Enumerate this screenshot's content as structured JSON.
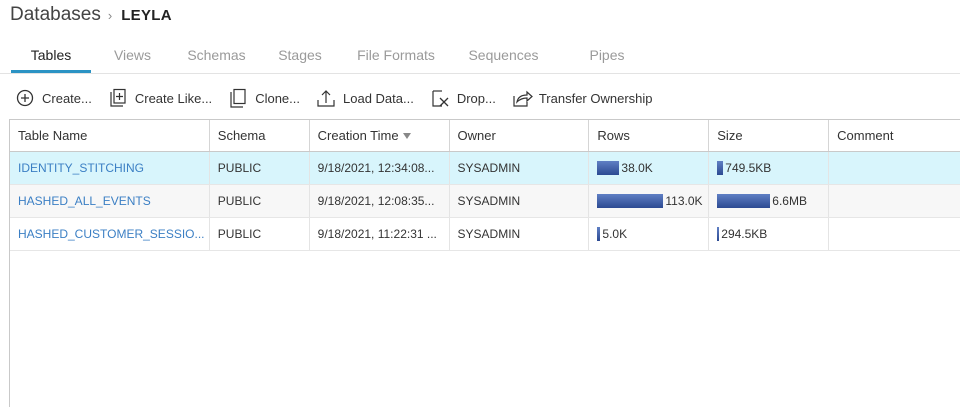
{
  "breadcrumb": {
    "root": "Databases",
    "separator": "›",
    "current": "LEYLA"
  },
  "tabs": [
    {
      "label": "Tables",
      "active": true
    },
    {
      "label": "Views",
      "active": false
    },
    {
      "label": "Schemas",
      "active": false
    },
    {
      "label": "Stages",
      "active": false
    },
    {
      "label": "File Formats",
      "active": false
    },
    {
      "label": "Sequences",
      "active": false
    },
    {
      "label": "Pipes",
      "active": false
    }
  ],
  "toolbar": {
    "create": "Create...",
    "create_like": "Create Like...",
    "clone": "Clone...",
    "load_data": "Load Data...",
    "drop": "Drop...",
    "transfer_ownership": "Transfer Ownership"
  },
  "table": {
    "columns": {
      "name": "Table Name",
      "schema": "Schema",
      "time": "Creation Time",
      "owner": "Owner",
      "rows": "Rows",
      "size": "Size",
      "comment": "Comment"
    },
    "rows": [
      {
        "name": "IDENTITY_STITCHING",
        "schema": "PUBLIC",
        "time": "9/18/2021, 12:34:08...",
        "owner": "SYSADMIN",
        "rows": "38.0K",
        "rows_fraction": 0.34,
        "size": "749.5KB",
        "size_fraction": 0.11,
        "comment": "",
        "selected": true
      },
      {
        "name": "HASHED_ALL_EVENTS",
        "schema": "PUBLIC",
        "time": "9/18/2021, 12:08:35...",
        "owner": "SYSADMIN",
        "rows": "113.0K",
        "rows_fraction": 1.0,
        "size": "6.6MB",
        "size_fraction": 1.0,
        "comment": "",
        "selected": false
      },
      {
        "name": "HASHED_CUSTOMER_SESSIO...",
        "schema": "PUBLIC",
        "time": "9/18/2021, 11:22:31 ...",
        "owner": "SYSADMIN",
        "rows": "5.0K",
        "rows_fraction": 0.044,
        "size": "294.5KB",
        "size_fraction": 0.044,
        "comment": "",
        "selected": false
      }
    ]
  },
  "colors": {
    "accent": "#2b93c4",
    "link": "#3b7fc4",
    "selected_row": "#d8f5fc",
    "bar": "#2c4a92"
  },
  "icons": {
    "create": "plus-circle-icon",
    "create_like": "plus-document-icon",
    "clone": "copy-icon",
    "load_data": "upload-icon",
    "drop": "delete-document-icon",
    "transfer_ownership": "share-icon",
    "sort": "sort-descending-icon"
  }
}
